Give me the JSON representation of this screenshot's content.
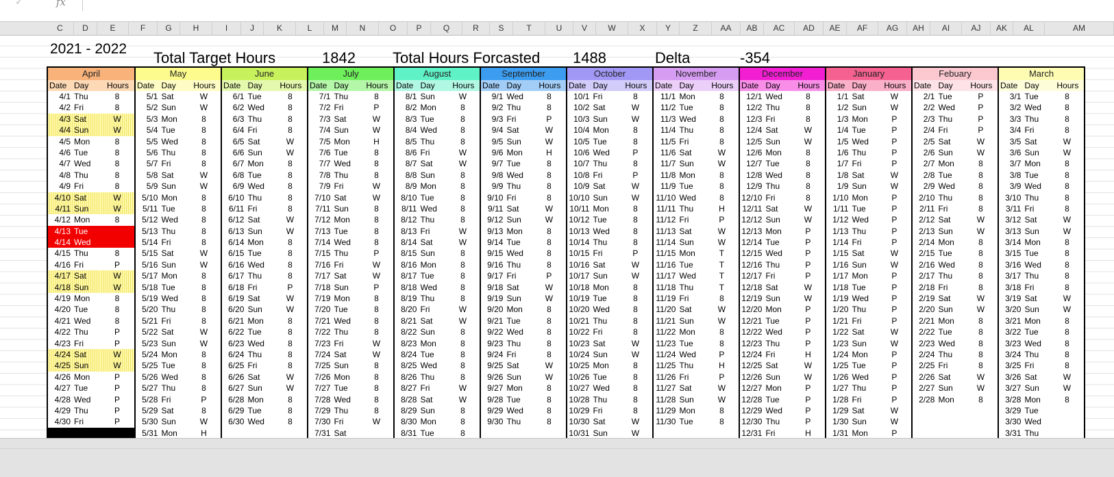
{
  "formula_bar": {
    "fx": "fx",
    "check": "✓"
  },
  "columns": [
    [
      "C",
      68,
      40
    ],
    [
      "D",
      108,
      34
    ],
    [
      "E",
      142,
      46
    ],
    [
      "F",
      188,
      42
    ],
    [
      "G",
      230,
      33
    ],
    [
      "H",
      263,
      47
    ],
    [
      "I",
      310,
      42
    ],
    [
      "J",
      352,
      33
    ],
    [
      "K",
      385,
      47
    ],
    [
      "L",
      432,
      41
    ],
    [
      "M",
      473,
      33
    ],
    [
      "N",
      506,
      47
    ],
    [
      "O",
      553,
      42
    ],
    [
      "P",
      595,
      34
    ],
    [
      "Q",
      629,
      46
    ],
    [
      "R",
      675,
      40
    ],
    [
      "S",
      715,
      34
    ],
    [
      "T",
      749,
      47
    ],
    [
      "U",
      796,
      41
    ],
    [
      "V",
      837,
      33
    ],
    [
      "W",
      870,
      47
    ],
    [
      "X",
      917,
      42
    ],
    [
      "Y",
      959,
      33
    ],
    [
      "Z",
      992,
      47
    ],
    [
      "AA",
      1039,
      42
    ],
    [
      "AB",
      1081,
      34
    ],
    [
      "AC",
      1115,
      45
    ],
    [
      "AD",
      1160,
      42
    ],
    [
      "AE",
      1202,
      34
    ],
    [
      "AF",
      1236,
      46
    ],
    [
      "AG",
      1282,
      42
    ],
    [
      "AH",
      1324,
      34
    ],
    [
      "AI",
      1358,
      46
    ],
    [
      "AJ",
      1404,
      42
    ],
    [
      "AK",
      1446,
      33
    ],
    [
      "AL",
      1479,
      46
    ],
    [
      "AM",
      1525,
      101
    ]
  ],
  "header": {
    "year": "2021 - 2022",
    "target_label": "Total Target Hours",
    "target_value": "1842",
    "forecast_label": "Total Hours Forcasted",
    "forecast_value": "1488",
    "delta_label": "Delta",
    "delta_value": "-354"
  },
  "col_labels": [
    "Date",
    "Day",
    "Hours"
  ],
  "months": [
    {
      "name": "April",
      "color": "#f8b27a",
      "head": "#fdd9b5",
      "start": "Thu",
      "days": 30,
      "hours": "8,8,W,W,8,8,8,8,8,W,W,8,,,8,P,W,W,8,8,8,P,P,W,W,P,P,P,P,P",
      "weekend": [
        3,
        4,
        10,
        11,
        17,
        18,
        24,
        25
      ],
      "red": [
        13,
        14
      ],
      "black": 31
    },
    {
      "name": "May",
      "color": "#fdfb8c",
      "head": "#fefcc4",
      "start": "Sat",
      "days": 31,
      "hours": "W,W,8,8,8,8,8,W,W,8,8,8,8,8,W,W,8,8,8,8,8,W,W,8,8,8,8,P,8,W,H"
    },
    {
      "name": "June",
      "color": "#c8f25c",
      "head": "#e5f9ae",
      "start": "Tue",
      "days": 30,
      "hours": "8,8,8,8,W,W,8,8,8,8,8,W,W,8,8,8,8,P,W,W,8,8,8,8,8,W,W,8,8,8"
    },
    {
      "name": "July",
      "color": "#6ef05a",
      "head": "#b4f7a9",
      "start": "Thu",
      "days": 31,
      "hours": "8,P,W,W,H,8,8,8,W,W,8,8,8,8,P,W,W,P,8,8,8,8,W,W,8,8,8,8,8,W"
    },
    {
      "name": "August",
      "color": "#5ff2c6",
      "head": "#b1f8e3",
      "start": "Sun",
      "days": 31,
      "hours": "W,8,8,8,8,W,W,8,8,8,8,8,W,W,8,8,8,8,8,W,W,8,8,8,8,8,W,W,8,8,8"
    },
    {
      "name": "September",
      "color": "#3b9cf0",
      "head": "#a2cdf7",
      "start": "Wed",
      "days": 30,
      "hours": "8,8,P,W,W,H,8,8,8,8,W,W,8,8,8,8,P,W,W,8,8,8,8,8,W,W,8,8,8,8"
    },
    {
      "name": "October",
      "color": "#a197f5",
      "head": "#d2ccfa",
      "start": "Fri",
      "days": 31,
      "hours": "8,W,W,8,8,P,8,P,W,W,8,8,8,8,P,W,W,8,8,8,8,8,W,W,8,8,8,8,8,W,W"
    },
    {
      "name": "November",
      "color": "#d69cf2",
      "head": "#ebcff9",
      "start": "Mon",
      "days": 30,
      "hours": "8,8,8,8,8,W,W,8,8,8,H,P,W,W,T,T,T,T,8,W,W,8,8,P,H,P,W,W,8,8"
    },
    {
      "name": "December",
      "color": "#f21ed2",
      "head": "#f98ee9",
      "start": "Wed",
      "days": 31,
      "hours": "8,8,8,W,W,8,8,8,8,8,W,W,P,P,P,P,P,W,W,P,P,P,P,H,W,W,P,P,P,P,H"
    },
    {
      "name": "January",
      "color": "#f56190",
      "head": "#fab0c8",
      "start": "Sat",
      "days": 31,
      "hours": "W,W,P,P,P,P,P,W,W,P,P,P,P,P,W,W,P,P,P,P,P,W,W,P,P,P,P,P,W,W,P"
    },
    {
      "name": "Febuary",
      "color": "#fbc8cf",
      "head": "#fde3e7",
      "start": "Tue",
      "days": 28,
      "hours": "P,P,P,P,W,W,8,8,8,8,8,W,W,8,8,8,8,8,W,W,8,8,8,8,8,W,W,8"
    },
    {
      "name": "March",
      "color": "#fdfcb2",
      "head": "#fefdda",
      "start": "Tue",
      "days": 31,
      "hours": "8,8,8,8,W,W,8,8,8,8,8,W,W,8,8,8,8,8,W,W,8,8,8,8,8,W,W,8,,,"
    }
  ],
  "colors": {
    "weekend": "#fef9a8",
    "sick": "#f20000"
  }
}
